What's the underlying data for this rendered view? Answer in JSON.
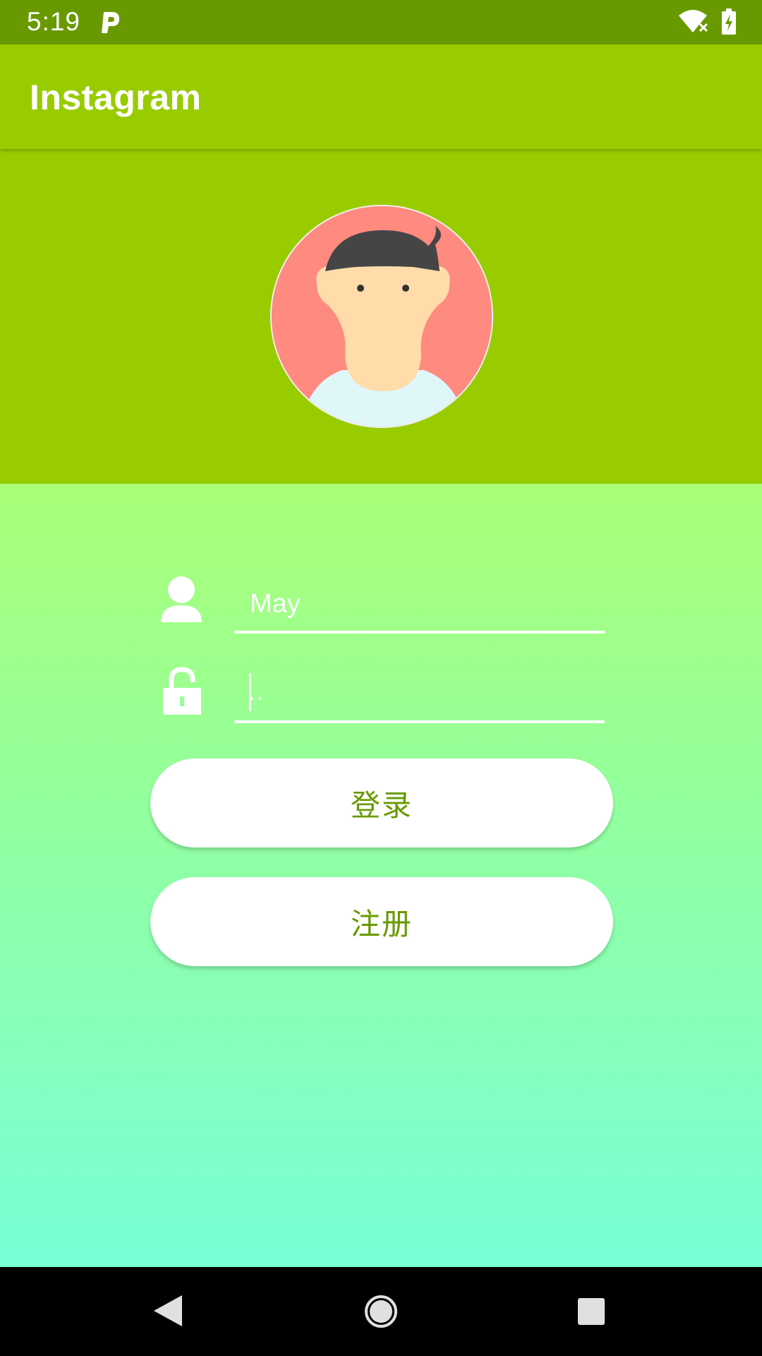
{
  "status_bar": {
    "time": "5:19",
    "notification_icon": "parking-p-icon",
    "wifi_icon": "wifi-no-internet-icon",
    "battery_icon": "battery-charging-icon"
  },
  "app_bar": {
    "title": "Instagram"
  },
  "profile": {
    "avatar_icon": "cartoon-boy-avatar-icon"
  },
  "form": {
    "username_value": "May",
    "password_mask": "..",
    "user_icon": "person-icon",
    "lock_icon": "unlocked-padlock-icon",
    "login_label": "登录",
    "register_label": "注册"
  },
  "nav_bar": {
    "back_icon": "triangle-back-icon",
    "home_icon": "circle-home-icon",
    "recent_icon": "square-recents-icon"
  },
  "colors": {
    "status_bar": "#689a00",
    "app_bar": "#99cc00",
    "gradient_top": "#aaff77",
    "gradient_bottom": "#78ffd6",
    "button_text": "#689a00",
    "avatar_bg": "#ff8a80"
  }
}
